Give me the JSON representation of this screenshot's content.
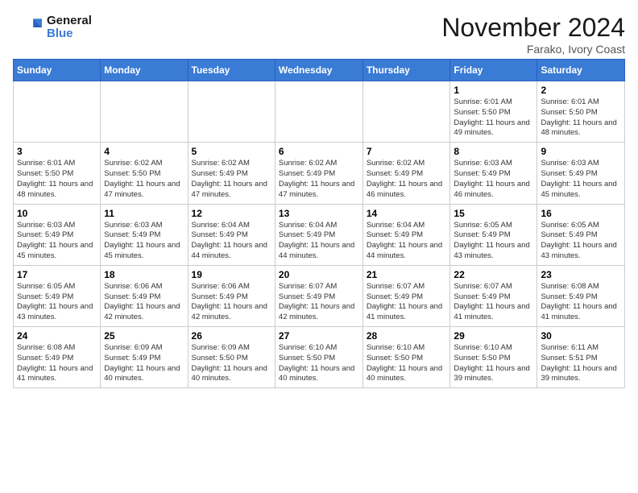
{
  "header": {
    "logo_line1": "General",
    "logo_line2": "Blue",
    "month": "November 2024",
    "location": "Farako, Ivory Coast"
  },
  "days_of_week": [
    "Sunday",
    "Monday",
    "Tuesday",
    "Wednesday",
    "Thursday",
    "Friday",
    "Saturday"
  ],
  "weeks": [
    [
      {
        "day": "",
        "info": ""
      },
      {
        "day": "",
        "info": ""
      },
      {
        "day": "",
        "info": ""
      },
      {
        "day": "",
        "info": ""
      },
      {
        "day": "",
        "info": ""
      },
      {
        "day": "1",
        "info": "Sunrise: 6:01 AM\nSunset: 5:50 PM\nDaylight: 11 hours and 49 minutes."
      },
      {
        "day": "2",
        "info": "Sunrise: 6:01 AM\nSunset: 5:50 PM\nDaylight: 11 hours and 48 minutes."
      }
    ],
    [
      {
        "day": "3",
        "info": "Sunrise: 6:01 AM\nSunset: 5:50 PM\nDaylight: 11 hours and 48 minutes."
      },
      {
        "day": "4",
        "info": "Sunrise: 6:02 AM\nSunset: 5:50 PM\nDaylight: 11 hours and 47 minutes."
      },
      {
        "day": "5",
        "info": "Sunrise: 6:02 AM\nSunset: 5:49 PM\nDaylight: 11 hours and 47 minutes."
      },
      {
        "day": "6",
        "info": "Sunrise: 6:02 AM\nSunset: 5:49 PM\nDaylight: 11 hours and 47 minutes."
      },
      {
        "day": "7",
        "info": "Sunrise: 6:02 AM\nSunset: 5:49 PM\nDaylight: 11 hours and 46 minutes."
      },
      {
        "day": "8",
        "info": "Sunrise: 6:03 AM\nSunset: 5:49 PM\nDaylight: 11 hours and 46 minutes."
      },
      {
        "day": "9",
        "info": "Sunrise: 6:03 AM\nSunset: 5:49 PM\nDaylight: 11 hours and 45 minutes."
      }
    ],
    [
      {
        "day": "10",
        "info": "Sunrise: 6:03 AM\nSunset: 5:49 PM\nDaylight: 11 hours and 45 minutes."
      },
      {
        "day": "11",
        "info": "Sunrise: 6:03 AM\nSunset: 5:49 PM\nDaylight: 11 hours and 45 minutes."
      },
      {
        "day": "12",
        "info": "Sunrise: 6:04 AM\nSunset: 5:49 PM\nDaylight: 11 hours and 44 minutes."
      },
      {
        "day": "13",
        "info": "Sunrise: 6:04 AM\nSunset: 5:49 PM\nDaylight: 11 hours and 44 minutes."
      },
      {
        "day": "14",
        "info": "Sunrise: 6:04 AM\nSunset: 5:49 PM\nDaylight: 11 hours and 44 minutes."
      },
      {
        "day": "15",
        "info": "Sunrise: 6:05 AM\nSunset: 5:49 PM\nDaylight: 11 hours and 43 minutes."
      },
      {
        "day": "16",
        "info": "Sunrise: 6:05 AM\nSunset: 5:49 PM\nDaylight: 11 hours and 43 minutes."
      }
    ],
    [
      {
        "day": "17",
        "info": "Sunrise: 6:05 AM\nSunset: 5:49 PM\nDaylight: 11 hours and 43 minutes."
      },
      {
        "day": "18",
        "info": "Sunrise: 6:06 AM\nSunset: 5:49 PM\nDaylight: 11 hours and 42 minutes."
      },
      {
        "day": "19",
        "info": "Sunrise: 6:06 AM\nSunset: 5:49 PM\nDaylight: 11 hours and 42 minutes."
      },
      {
        "day": "20",
        "info": "Sunrise: 6:07 AM\nSunset: 5:49 PM\nDaylight: 11 hours and 42 minutes."
      },
      {
        "day": "21",
        "info": "Sunrise: 6:07 AM\nSunset: 5:49 PM\nDaylight: 11 hours and 41 minutes."
      },
      {
        "day": "22",
        "info": "Sunrise: 6:07 AM\nSunset: 5:49 PM\nDaylight: 11 hours and 41 minutes."
      },
      {
        "day": "23",
        "info": "Sunrise: 6:08 AM\nSunset: 5:49 PM\nDaylight: 11 hours and 41 minutes."
      }
    ],
    [
      {
        "day": "24",
        "info": "Sunrise: 6:08 AM\nSunset: 5:49 PM\nDaylight: 11 hours and 41 minutes."
      },
      {
        "day": "25",
        "info": "Sunrise: 6:09 AM\nSunset: 5:49 PM\nDaylight: 11 hours and 40 minutes."
      },
      {
        "day": "26",
        "info": "Sunrise: 6:09 AM\nSunset: 5:50 PM\nDaylight: 11 hours and 40 minutes."
      },
      {
        "day": "27",
        "info": "Sunrise: 6:10 AM\nSunset: 5:50 PM\nDaylight: 11 hours and 40 minutes."
      },
      {
        "day": "28",
        "info": "Sunrise: 6:10 AM\nSunset: 5:50 PM\nDaylight: 11 hours and 40 minutes."
      },
      {
        "day": "29",
        "info": "Sunrise: 6:10 AM\nSunset: 5:50 PM\nDaylight: 11 hours and 39 minutes."
      },
      {
        "day": "30",
        "info": "Sunrise: 6:11 AM\nSunset: 5:51 PM\nDaylight: 11 hours and 39 minutes."
      }
    ]
  ]
}
